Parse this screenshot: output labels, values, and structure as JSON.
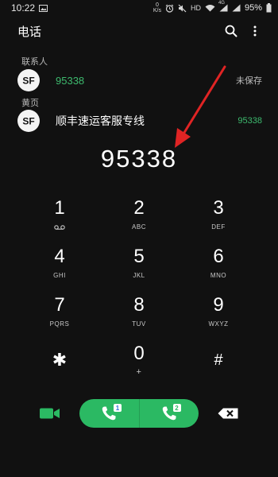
{
  "status_bar": {
    "time": "10:22",
    "speed_value": "0",
    "speed_unit": "K/s",
    "hd_label": "HD",
    "network_label": "4G",
    "battery": "95%"
  },
  "header": {
    "title": "电话"
  },
  "contacts_section": {
    "label": "联系人",
    "result": {
      "number": "95338",
      "status": "未保存"
    }
  },
  "yellow_pages_section": {
    "label": "黄页",
    "result": {
      "name": "顺丰速运客服专线",
      "number": "95338"
    }
  },
  "dialer": {
    "typed_number": "95338",
    "keys": [
      {
        "digit": "1",
        "letters": ""
      },
      {
        "digit": "2",
        "letters": "ABC"
      },
      {
        "digit": "3",
        "letters": "DEF"
      },
      {
        "digit": "4",
        "letters": "GHI"
      },
      {
        "digit": "5",
        "letters": "JKL"
      },
      {
        "digit": "6",
        "letters": "MNO"
      },
      {
        "digit": "7",
        "letters": "PQRS"
      },
      {
        "digit": "8",
        "letters": "TUV"
      },
      {
        "digit": "9",
        "letters": "WXYZ"
      },
      {
        "digit": "✱",
        "letters": ""
      },
      {
        "digit": "0",
        "letters": "+"
      },
      {
        "digit": "#",
        "letters": ""
      }
    ]
  },
  "bottom_bar": {
    "sim1_label": "1",
    "sim2_label": "2"
  },
  "colors": {
    "accent_green": "#2bb963",
    "text_green": "#3dba6e",
    "annotation_red": "#e02424",
    "background": "#111111"
  }
}
